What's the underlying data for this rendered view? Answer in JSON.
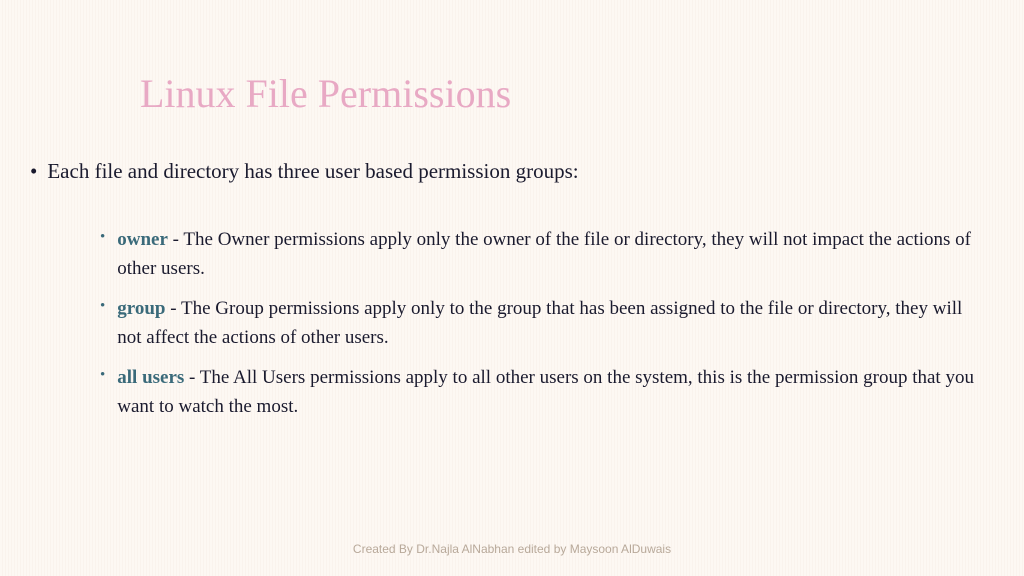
{
  "title": "Linux File Permissions",
  "main_text": "Each file and directory has three user based permission groups:",
  "items": [
    {
      "term": "owner",
      "description": " - The Owner permissions apply only the owner of the file or directory, they will not impact the actions of other users."
    },
    {
      "term": "group",
      "description": " - The Group permissions apply only to the group that has been assigned to the file or directory, they will not affect the actions of other users."
    },
    {
      "term": "all users",
      "description": " - The All Users permissions apply to all other users on the system, this is the permission group that you want to watch the most."
    }
  ],
  "footer": "Created By Dr.Najla AlNabhan edited by Maysoon AlDuwais"
}
